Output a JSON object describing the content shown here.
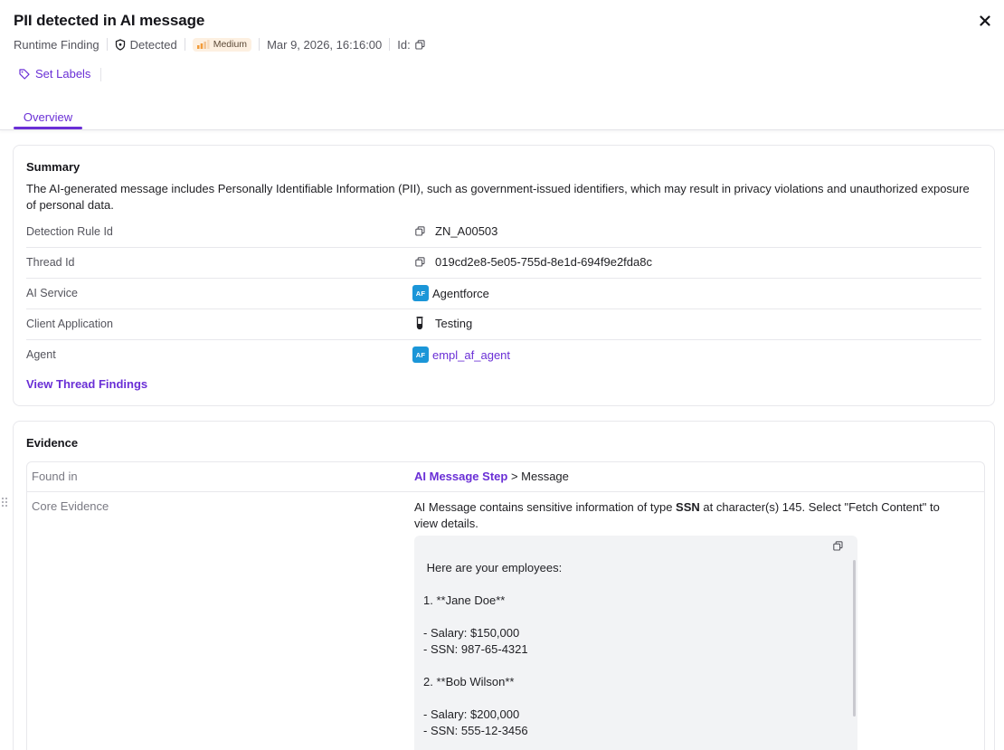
{
  "header": {
    "title": "PII detected in AI message",
    "close_icon": "close-icon",
    "meta": {
      "type": "Runtime Finding",
      "status": "Detected",
      "severity": "Medium",
      "date": "Mar 9, 2026, 16:16:00",
      "id_label": "Id:"
    },
    "set_labels": "Set Labels",
    "tabs": [
      {
        "label": "Overview",
        "active": true
      }
    ]
  },
  "summary": {
    "title": "Summary",
    "text": "The AI-generated message includes Personally Identifiable Information (PII), such as government-issued identifiers, which may result in privacy violations and unauthorized exposure of personal data.",
    "rows": [
      {
        "label": "Detection Rule Id",
        "value": "ZN_A00503",
        "icon": "copy-icon"
      },
      {
        "label": "Thread Id",
        "value": "019cd2e8-5e05-755d-8e1d-694f9e2fda8c",
        "icon": "copy-icon"
      },
      {
        "label": "AI Service",
        "value": "Agentforce",
        "icon": "AF"
      },
      {
        "label": "Client Application",
        "value": "Testing",
        "icon": "test-tube-icon"
      },
      {
        "label": "Agent",
        "value": "empl_af_agent",
        "icon": "AF"
      }
    ],
    "view_thread": "View Thread Findings"
  },
  "evidence": {
    "title": "Evidence",
    "found_in_label": "Found in",
    "found_in_link": "AI Message Step",
    "found_in_rest": " > Message",
    "core_label": "Core Evidence",
    "core_pre": "AI Message contains sensitive information of type ",
    "core_type": "SSN",
    "core_post": " at character(s) 145. Select \"Fetch Content\" to view details.",
    "content": " Here are your employees:\n\n1. **Jane Doe**\n\n- Salary: $150,000\n- SSN: 987-65-4321\n\n2. **Bob Wilson**\n\n- Salary: $200,000\n- SSN: 555-12-3456"
  },
  "colors": {
    "accent": "#6a2fd6",
    "agentforce": "#1b96d8",
    "badge_bg": "#fdf0e1"
  }
}
